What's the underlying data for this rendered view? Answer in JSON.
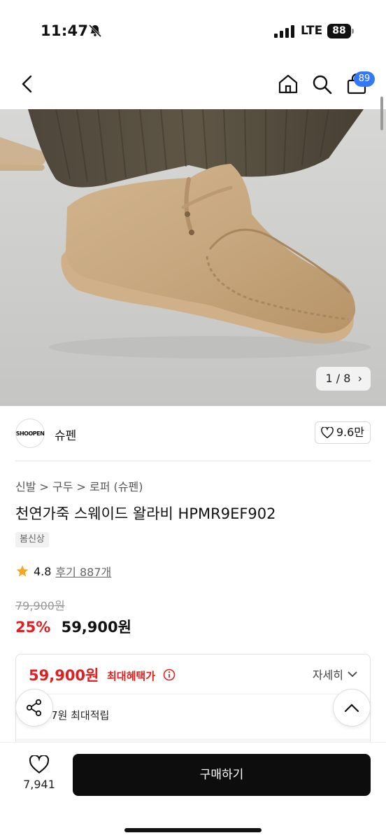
{
  "status_bar": {
    "time": "11:47",
    "network": "LTE",
    "battery": "88"
  },
  "nav": {
    "cart_count": "89"
  },
  "gallery": {
    "counter": "1 / 8"
  },
  "brand": {
    "logo_text": "SHOOPEN",
    "name": "슈펜",
    "likes": "9.6만"
  },
  "product": {
    "breadcrumb": "신발 > 구두 > 로퍼 (슈펜)",
    "title": "천연가죽 스웨이드 왈라비 HPMR9EF902",
    "tag": "봄신상",
    "rating": "4.8",
    "reviews": "후기 887개",
    "original_price": "79,900원",
    "discount": "25%",
    "sale_price": "59,900원"
  },
  "benefit": {
    "price": "59,900원",
    "label": "최대혜택가",
    "detail": "자세히",
    "points": "7원 최대적립"
  },
  "bottom": {
    "wish_count": "7,941",
    "buy_label": "구매하기"
  }
}
